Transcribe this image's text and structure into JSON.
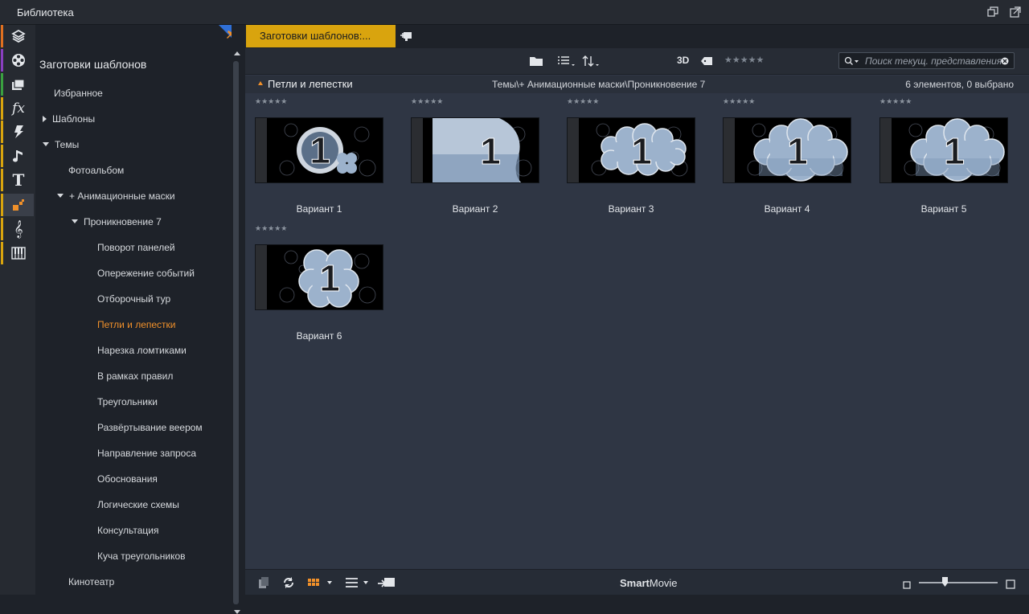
{
  "window": {
    "title": "Библиотека"
  },
  "sidebar_icons": [
    {
      "name": "project-bin-icon",
      "color": "#e07020"
    },
    {
      "name": "film-reel-icon",
      "color": "#8a3fc0"
    },
    {
      "name": "photos-icon",
      "color": "#3aa040"
    },
    {
      "name": "fx-icon",
      "color": "#d9a40e"
    },
    {
      "name": "transitions-icon",
      "color": "#d9a40e"
    },
    {
      "name": "music-icon",
      "color": "#d9a40e"
    },
    {
      "name": "title-icon",
      "color": "#d9a40e"
    },
    {
      "name": "montage-icon",
      "color": "#d9a40e"
    },
    {
      "name": "score-icon",
      "color": "#d9a40e"
    },
    {
      "name": "piano-icon",
      "color": "#d9a40e"
    }
  ],
  "tree": {
    "root": "Заготовки шаблонов",
    "items": [
      {
        "label": "Избранное",
        "toggle": "",
        "level": 0
      },
      {
        "label": "Шаблоны",
        "toggle": "right",
        "level": 0
      },
      {
        "label": "Темы",
        "toggle": "down",
        "level": 0
      },
      {
        "label": "Фотоальбом",
        "toggle": "",
        "level": 1
      },
      {
        "label": "+ Анимационные маски",
        "toggle": "down",
        "level": 1
      },
      {
        "label": "Проникновение 7",
        "toggle": "down",
        "level": 2
      },
      {
        "label": "Поворот панелей",
        "toggle": "",
        "level": 3
      },
      {
        "label": "Опережение событий",
        "toggle": "",
        "level": 3
      },
      {
        "label": "Отборочный тур",
        "toggle": "",
        "level": 3
      },
      {
        "label": "Петли и лепестки",
        "toggle": "",
        "level": 3,
        "active": true
      },
      {
        "label": "Нарезка ломтиками",
        "toggle": "",
        "level": 3
      },
      {
        "label": "В рамках правил",
        "toggle": "",
        "level": 3
      },
      {
        "label": "Треугольники",
        "toggle": "",
        "level": 3
      },
      {
        "label": "Развёртывание веером",
        "toggle": "",
        "level": 3
      },
      {
        "label": "Направление запроса",
        "toggle": "",
        "level": 3
      },
      {
        "label": "Обоснования",
        "toggle": "",
        "level": 3
      },
      {
        "label": "Логические схемы",
        "toggle": "",
        "level": 3
      },
      {
        "label": "Консультация",
        "toggle": "",
        "level": 3
      },
      {
        "label": "Куча треугольников",
        "toggle": "",
        "level": 3
      },
      {
        "label": "Кинотеатр",
        "toggle": "",
        "level": 1
      }
    ]
  },
  "tab": {
    "label": "Заготовки шаблонов:..."
  },
  "toolbar": {
    "mode_3d": "3D",
    "search_placeholder": "Поиск текущ. представления"
  },
  "pathbar": {
    "folder": "Петли и лепестки",
    "path": "Темы\\+ Анимационные маски\\Проникновение 7",
    "count": "6 элементов, 0 выбрано"
  },
  "items": [
    {
      "label": "Вариант 1",
      "stars": "★★★★★",
      "digit": "1",
      "shape": "ring"
    },
    {
      "label": "Вариант 2",
      "stars": "★★★★★",
      "digit": "1",
      "shape": "panel"
    },
    {
      "label": "Вариант 3",
      "stars": "★★★★★",
      "digit": "1",
      "shape": "cloud-wide"
    },
    {
      "label": "Вариант 4",
      "stars": "★★★★★",
      "digit": "1",
      "shape": "cloud-big"
    },
    {
      "label": "Вариант 5",
      "stars": "★★★★★",
      "digit": "1",
      "shape": "cloud-big"
    },
    {
      "label": "Вариант 6",
      "stars": "★★★★★",
      "digit": "1",
      "shape": "flower"
    }
  ],
  "bottom": {
    "brand_bold": "Smart",
    "brand_rest": "Movie"
  },
  "colors": {
    "accent": "#f0902a",
    "tab": "#d9a40e"
  }
}
